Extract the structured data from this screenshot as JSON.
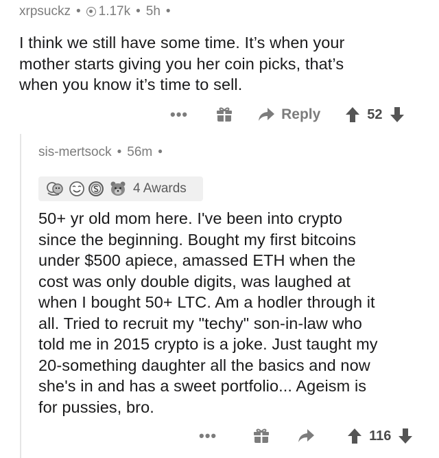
{
  "parent_comment": {
    "username": "xrpsuckz",
    "separator": "•",
    "karma": "1.17k",
    "age": "5h",
    "lines": [
      "I think we still have some time. It’s when your",
      "mother starts giving you her coin picks, that’s",
      "when you know it’s time to sell."
    ],
    "more_label": "•••",
    "reply_label": "Reply",
    "score": "52"
  },
  "child_comment": {
    "username": "sis-mertsock",
    "separator": "•",
    "age": "56m",
    "awards_label": "4 Awards",
    "lines": [
      "50+ yr old mom here.  I've been into crypto",
      "since the beginning.  Bought my first bitcoins",
      "under $500 apiece, amassed ETH when the",
      "cost was only double digits, was laughed at",
      "when I bought 50+ LTC.  Am a hodler through it",
      "all.  Tried to recruit my \"techy\" son-in-law who",
      "told me in 2015 crypto is a joke.  Just taught my",
      "20-something daughter all the basics and now",
      "she's in and has a sweet portfolio... Ageism is",
      "for pussies, bro."
    ],
    "more_label": "•••",
    "score": "116"
  },
  "colors": {
    "meta_gray": "#7c7c7c",
    "text": "#1a1a1b",
    "awards_bg": "#f0f0f0"
  },
  "icons": [
    "karma-icon",
    "gift-icon",
    "reply-arrow-icon",
    "upvote-icon",
    "downvote-icon",
    "award-icons"
  ]
}
